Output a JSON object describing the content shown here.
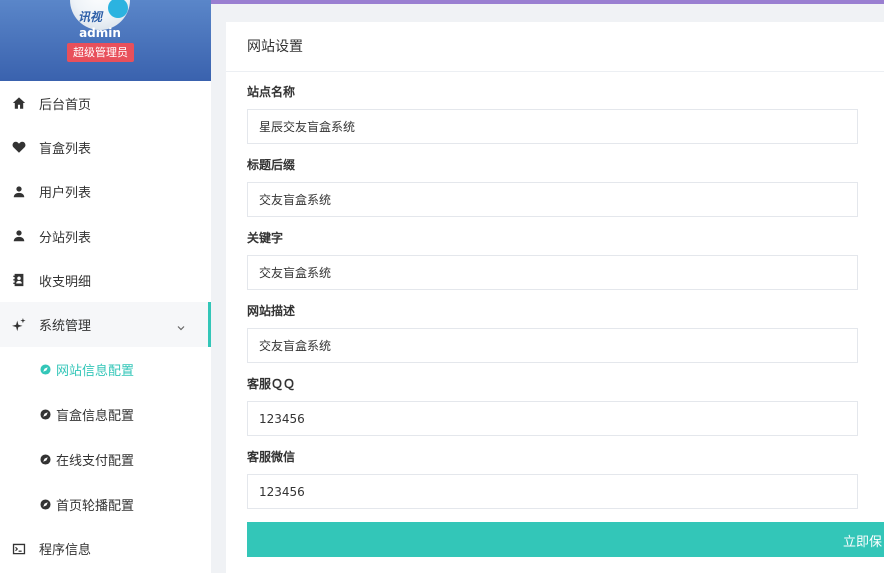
{
  "profile": {
    "avatar_text": "讯视",
    "username": "admin",
    "role": "超级管理员"
  },
  "menu": [
    {
      "label": "后台首页",
      "icon": "home-icon"
    },
    {
      "label": "盲盒列表",
      "icon": "heart-icon"
    },
    {
      "label": "用户列表",
      "icon": "user-icon"
    },
    {
      "label": "分站列表",
      "icon": "user-icon"
    },
    {
      "label": "收支明细",
      "icon": "contact-book-icon"
    },
    {
      "label": "系统管理",
      "icon": "sparkle-icon",
      "expanded": true
    }
  ],
  "submenu": [
    {
      "label": "网站信息配置",
      "current": true
    },
    {
      "label": "盲盒信息配置"
    },
    {
      "label": "在线支付配置"
    },
    {
      "label": "首页轮播配置"
    }
  ],
  "menu_after": {
    "label": "程序信息",
    "icon": "terminal-icon"
  },
  "panel": {
    "title": "网站设置",
    "fields": [
      {
        "label": "站点名称",
        "value": "星辰交友盲盒系统"
      },
      {
        "label": "标题后缀",
        "value": "交友盲盒系统"
      },
      {
        "label": "关键字",
        "value": "交友盲盒系统"
      },
      {
        "label": "网站描述",
        "value": "交友盲盒系统"
      },
      {
        "label": "客服ＱＱ",
        "value": "123456"
      },
      {
        "label": "客服微信",
        "value": "123456"
      }
    ],
    "save_label": "立即保"
  },
  "colors": {
    "accent": "#33c6b8",
    "badge": "#e8505b",
    "profile_bg": "#4a74bd",
    "top_bar": "#9a7fd1"
  }
}
